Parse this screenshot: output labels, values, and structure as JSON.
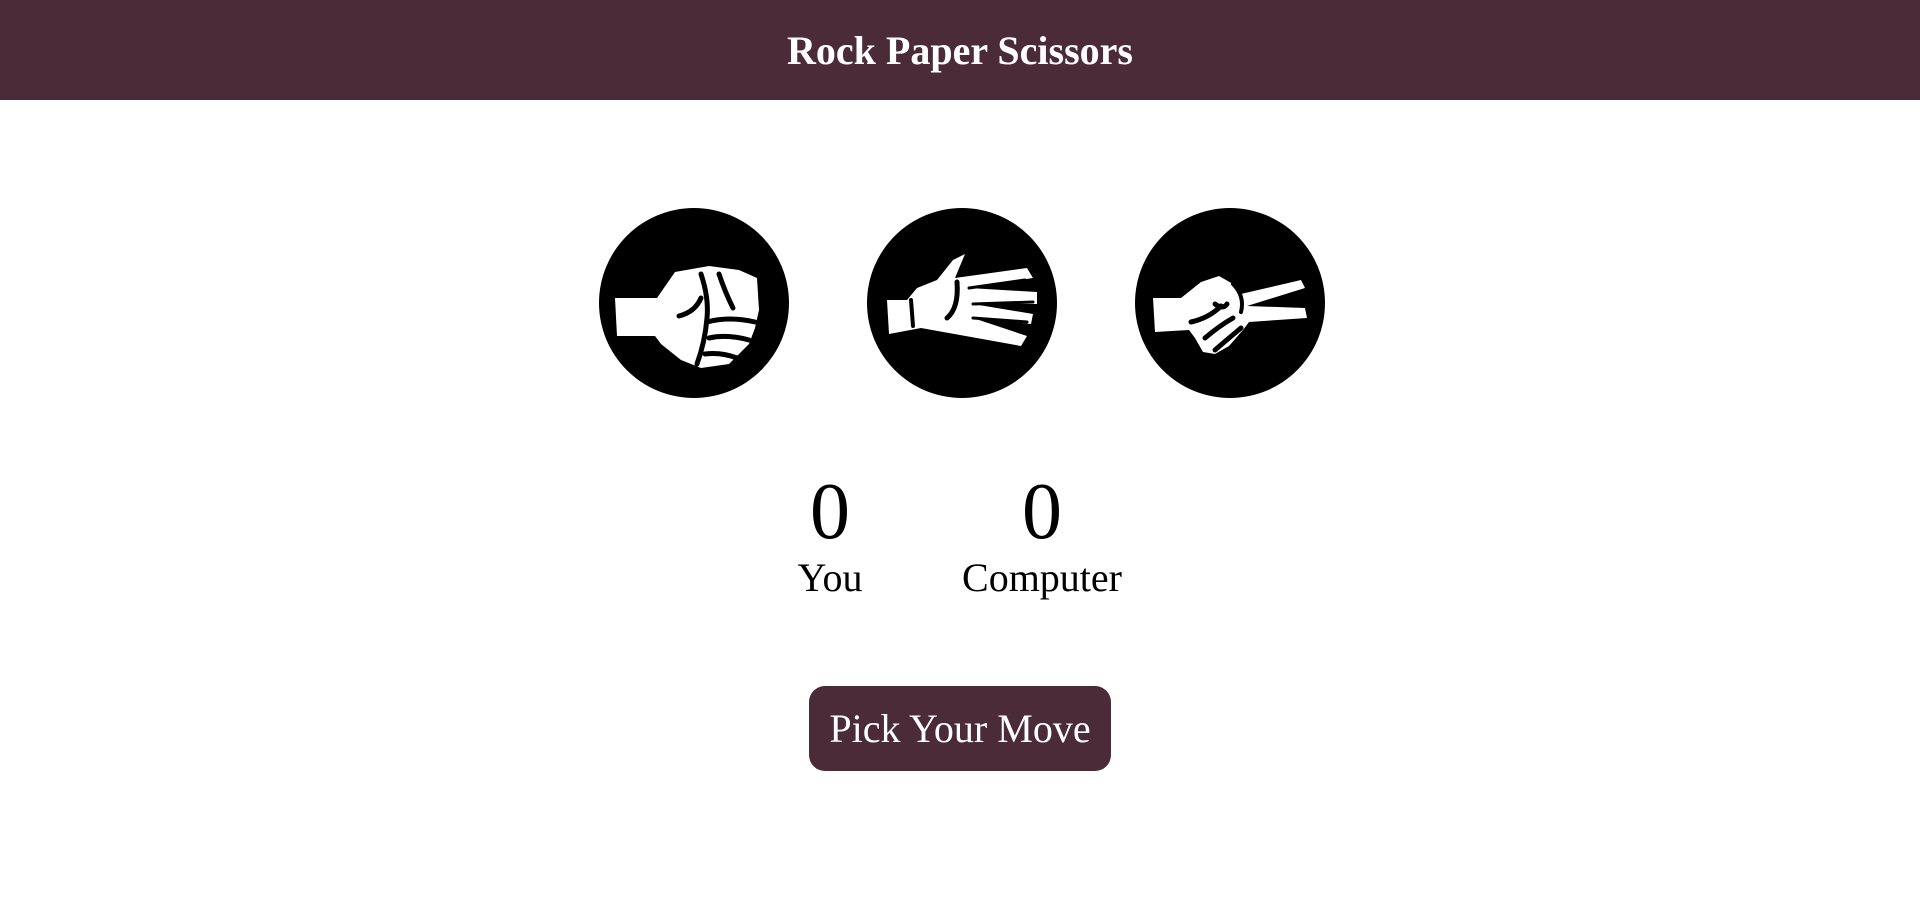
{
  "header": {
    "title": "Rock Paper Scissors"
  },
  "colors": {
    "brand": "#4b2b37",
    "icon_bg": "#000000",
    "icon_fg": "#ffffff"
  },
  "moves": [
    {
      "icon": "rock-hand-icon"
    },
    {
      "icon": "paper-hand-icon"
    },
    {
      "icon": "scissors-hand-icon"
    }
  ],
  "scores": {
    "you": {
      "value": "0",
      "label": "You"
    },
    "computer": {
      "value": "0",
      "label": "Computer"
    }
  },
  "action": {
    "label": "Pick Your Move"
  }
}
